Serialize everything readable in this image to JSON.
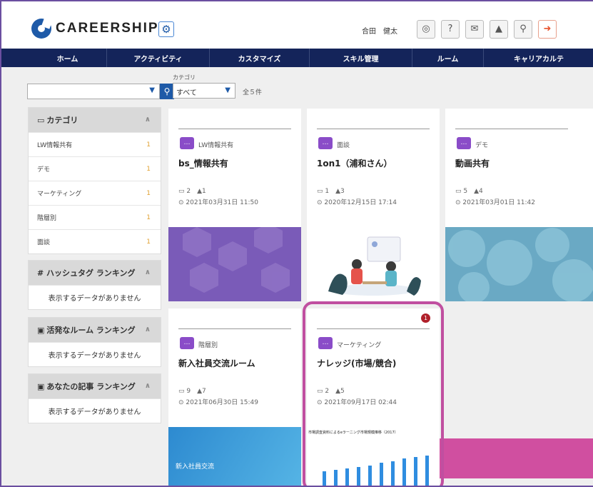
{
  "header": {
    "logo_text": "CAREERSHIP",
    "user_name": "合田　健太"
  },
  "nav": [
    "ホーム",
    "アクティビティ",
    "カスタマイズ",
    "スキル管理",
    "ルーム",
    "キャリアカルテ"
  ],
  "filter": {
    "category_label": "カテゴリ",
    "category_value": "すべて",
    "count_text": "全５件"
  },
  "sidebar": {
    "category_title": "カテゴリ",
    "categories": [
      {
        "label": "LW情報共有",
        "count": "1"
      },
      {
        "label": "デモ",
        "count": "1"
      },
      {
        "label": "マーケティング",
        "count": "1"
      },
      {
        "label": "階層別",
        "count": "1"
      },
      {
        "label": "面談",
        "count": "1"
      }
    ],
    "hashtag_title": "# ハッシュタグ ランキング",
    "active_title": "活発なルーム ランキング",
    "yours_title": "あなたの記事 ランキング",
    "empty_text": "表示するデータがありません"
  },
  "rooms": [
    {
      "category": "LW情報共有",
      "title": "bs_情報共有",
      "docs": "2",
      "members": "1",
      "date": "2021年03月31日 11:50"
    },
    {
      "category": "面談",
      "title": "1on1（浦和さん）",
      "docs": "1",
      "members": "3",
      "date": "2020年12月15日 17:14"
    },
    {
      "category": "デモ",
      "title": "動画共有",
      "docs": "5",
      "members": "4",
      "date": "2021年03月01日 11:42"
    },
    {
      "category": "階層別",
      "title": "新入社員交流ルーム",
      "docs": "9",
      "members": "7",
      "date": "2021年06月30日 15:49",
      "image_text": "新入社員交流"
    },
    {
      "category": "マーケティング",
      "title": "ナレッジ(市場/競合)",
      "docs": "2",
      "members": "5",
      "date": "2021年09月17日 02:44",
      "notification": "1",
      "image_text": "市場調査資料によるeラーニング市場規模推移（2017）"
    }
  ],
  "colors": {
    "navbar": "#14245a",
    "accent": "#1e5aa8",
    "badge": "#8a4cc8",
    "highlight": "#c04fa0"
  }
}
